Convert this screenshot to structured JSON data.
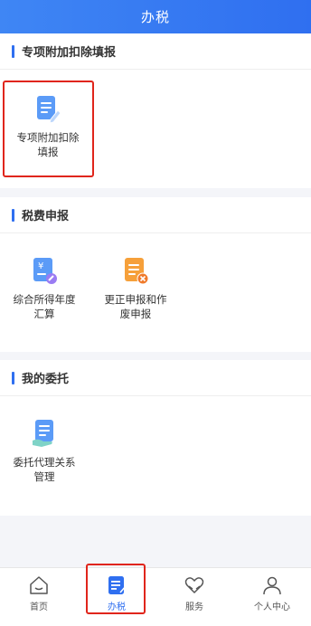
{
  "header": {
    "title": "办税"
  },
  "sections": [
    {
      "title": "专项附加扣除填报",
      "items": [
        {
          "label": "专项附加扣除填报",
          "icon": "document-edit-icon"
        }
      ]
    },
    {
      "title": "税费申报",
      "items": [
        {
          "label": "综合所得年度汇算",
          "icon": "yuan-document-icon"
        },
        {
          "label": "更正申报和作废申报",
          "icon": "document-cancel-icon"
        }
      ]
    },
    {
      "title": "我的委托",
      "items": [
        {
          "label": "委托代理关系管理",
          "icon": "document-hand-icon"
        }
      ]
    }
  ],
  "tabbar": [
    {
      "label": "首页",
      "icon": "home-icon",
      "active": false
    },
    {
      "label": "办税",
      "icon": "tax-document-icon",
      "active": true
    },
    {
      "label": "服务",
      "icon": "heart-hands-icon",
      "active": false
    },
    {
      "label": "个人中心",
      "icon": "person-icon",
      "active": false
    }
  ],
  "colors": {
    "accent": "#2f6ff0",
    "highlight": "#e0251b",
    "orange": "#f6a03a"
  }
}
